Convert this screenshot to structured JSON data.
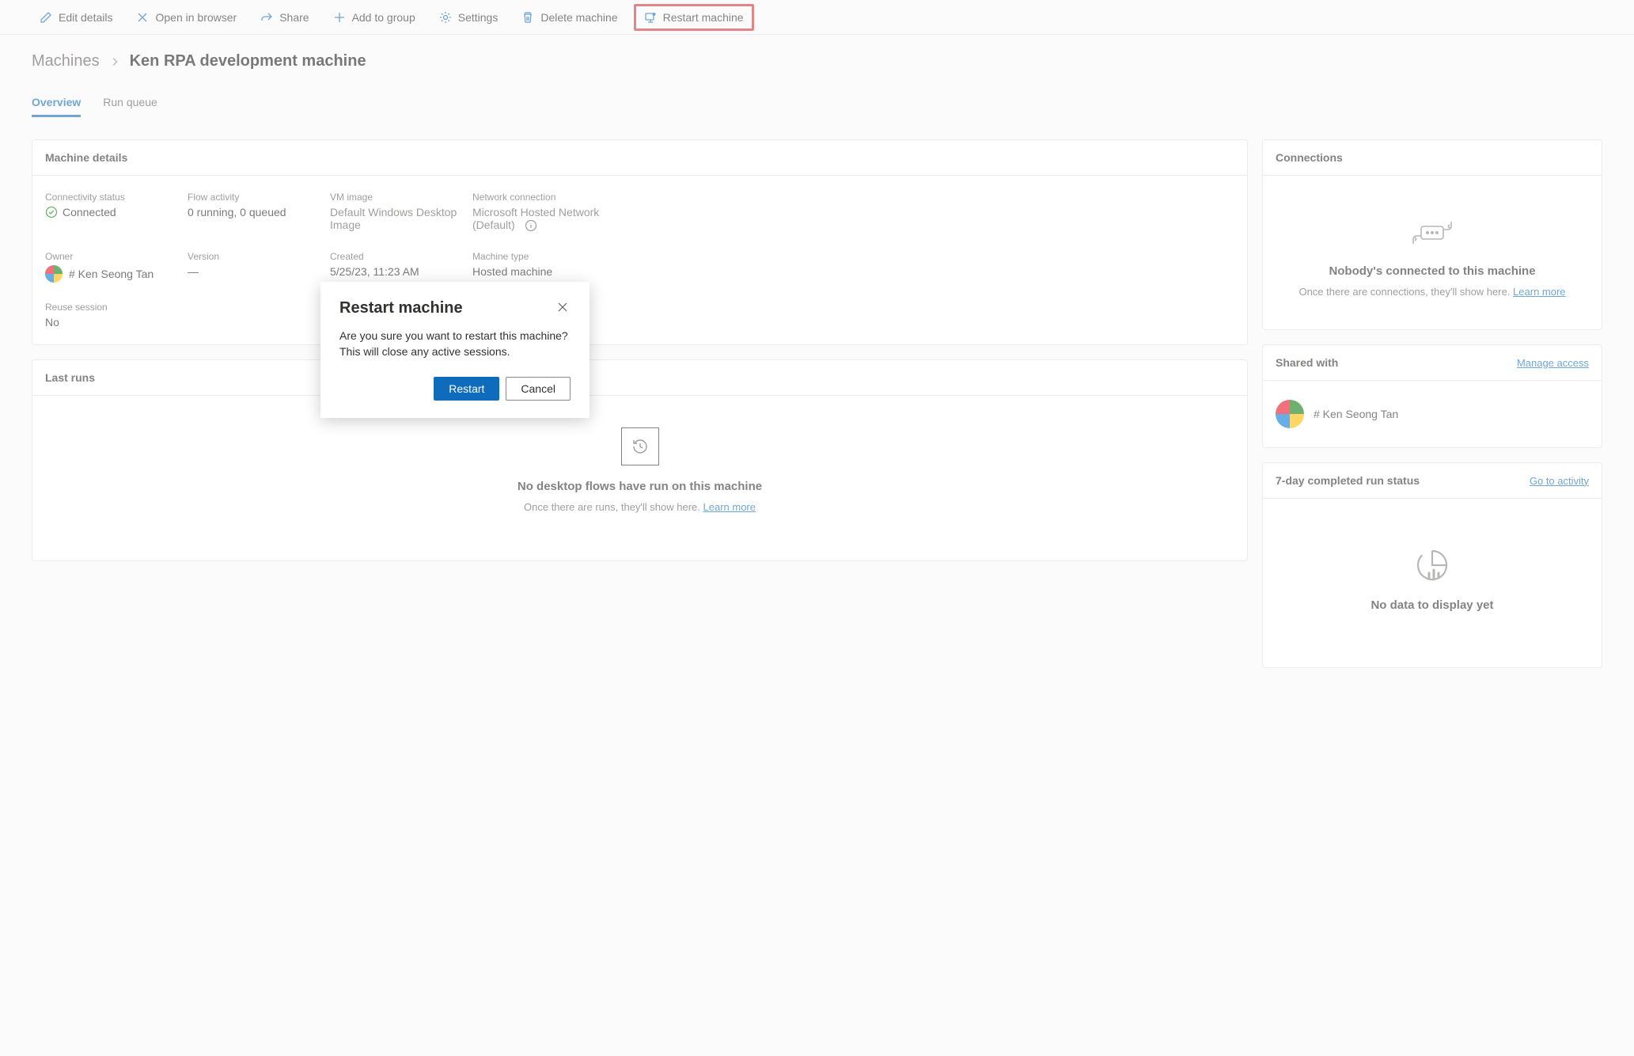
{
  "command_bar": {
    "edit": "Edit details",
    "open_browser": "Open in browser",
    "share": "Share",
    "add_group": "Add to group",
    "settings": "Settings",
    "delete": "Delete machine",
    "restart": "Restart machine"
  },
  "breadcrumb": {
    "root": "Machines",
    "current": "Ken RPA development machine"
  },
  "tabs": {
    "overview": "Overview",
    "run_queue": "Run queue"
  },
  "details_card": {
    "title": "Machine details",
    "connectivity_label": "Connectivity status",
    "connectivity_value": "Connected",
    "flow_label": "Flow activity",
    "flow_value": "0 running, 0 queued",
    "vm_label": "VM image",
    "vm_value": "Default Windows Desktop Image",
    "network_label": "Network connection",
    "network_value": "Microsoft Hosted Network (Default)",
    "owner_label": "Owner",
    "owner_value": "# Ken Seong Tan",
    "version_label": "Version",
    "version_value": "—",
    "created_label": "Created",
    "created_value": "5/25/23, 11:23 AM",
    "type_label": "Machine type",
    "type_value": "Hosted machine",
    "reuse_label": "Reuse session",
    "reuse_value": "No"
  },
  "last_runs_card": {
    "title": "Last runs",
    "empty_title": "No desktop flows have run on this machine",
    "empty_sub": "Once there are runs, they'll show here. ",
    "learn_more": "Learn more"
  },
  "connections_card": {
    "title": "Connections",
    "empty_title": "Nobody's connected to this machine",
    "empty_sub": "Once there are connections, they'll show here. ",
    "learn_more": "Learn more"
  },
  "shared_card": {
    "title": "Shared with",
    "manage": "Manage access",
    "user": "# Ken Seong Tan"
  },
  "run_status_card": {
    "title": "7-day completed run status",
    "link": "Go to activity",
    "empty_title": "No data to display yet"
  },
  "dialog": {
    "title": "Restart machine",
    "body": "Are you sure you want to restart this machine? This will close any active sessions.",
    "restart": "Restart",
    "cancel": "Cancel"
  }
}
